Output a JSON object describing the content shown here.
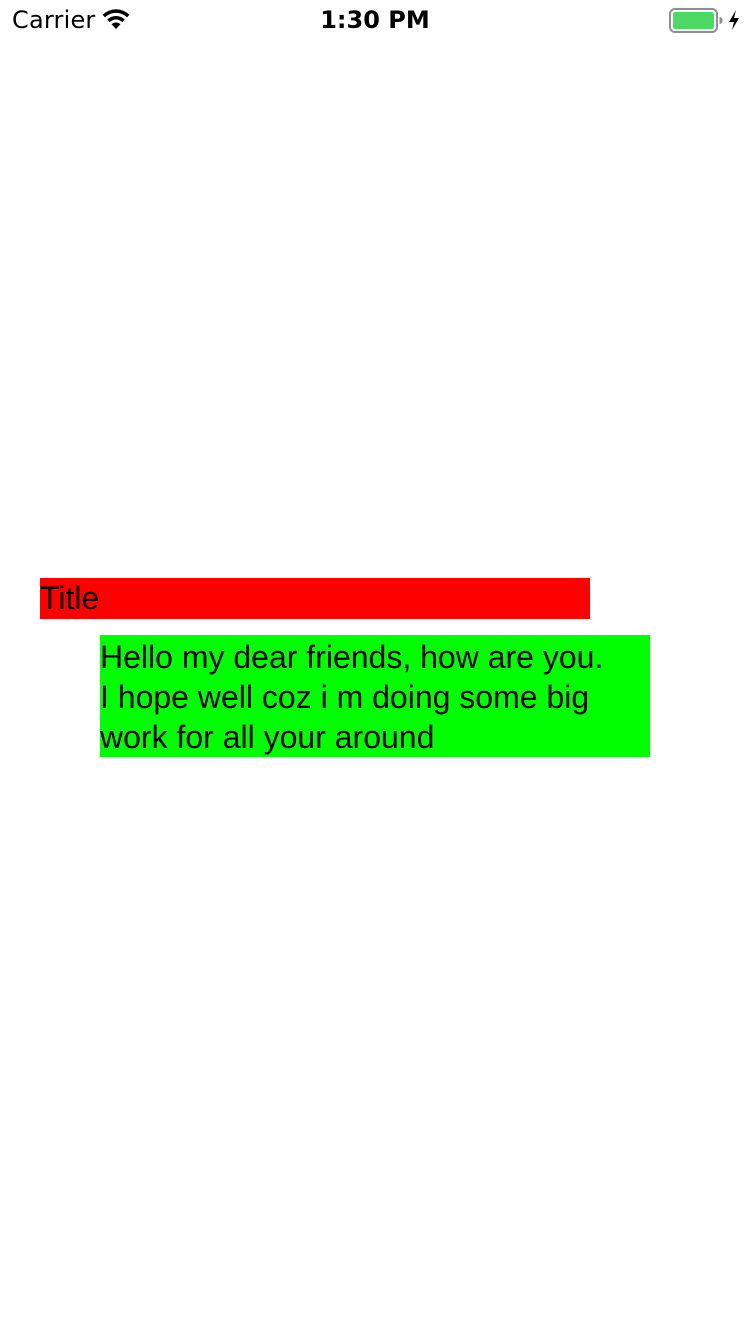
{
  "status_bar": {
    "carrier": "Carrier",
    "time": "1:30 PM",
    "battery_color": "#4cd964",
    "icons": [
      "wifi-icon",
      "battery-icon",
      "charging-icon"
    ]
  },
  "content": {
    "title": "Title",
    "title_background": "#ff0000",
    "body_lines": [
      "Hello my dear friends, how are you.",
      "I hope well coz i m doing some big",
      "work for all your around"
    ],
    "body_background": "#00ff00"
  }
}
